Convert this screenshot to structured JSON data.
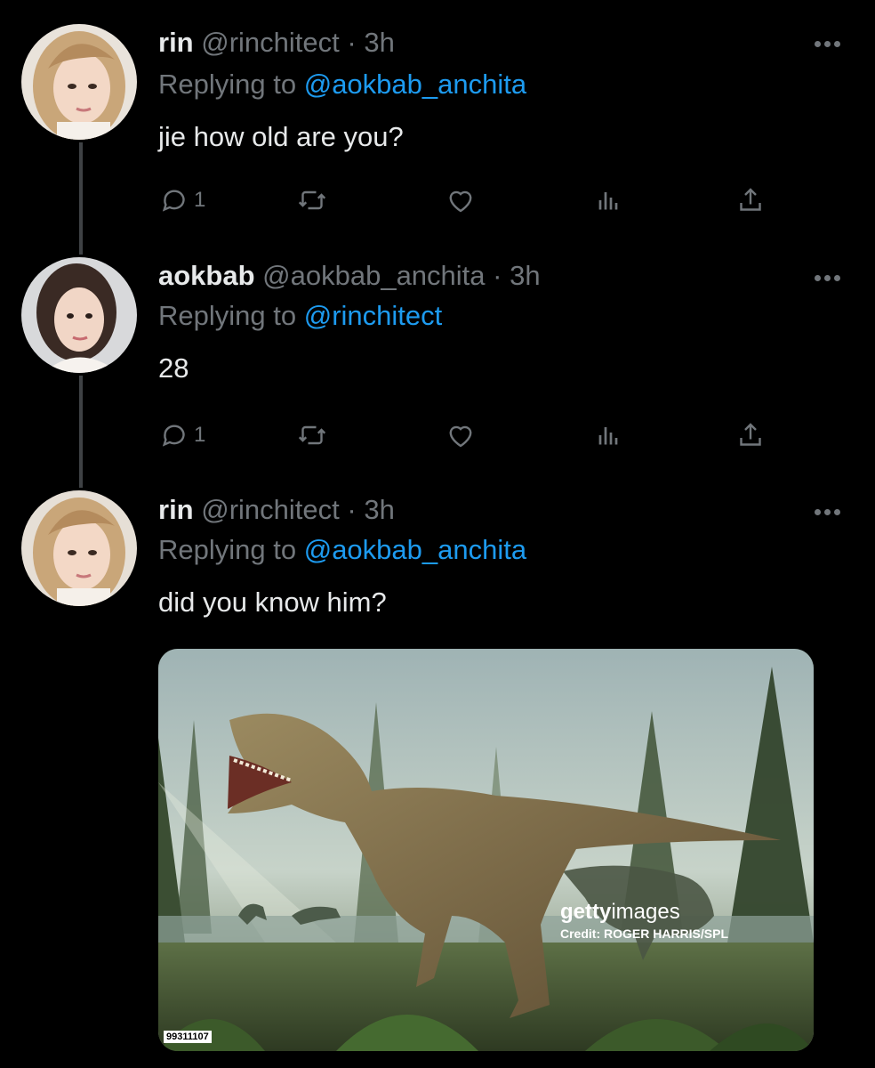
{
  "tweets": [
    {
      "name": "rin",
      "handle": "@rinchitect",
      "time": "· 3h",
      "replying_prefix": "Replying to",
      "replying_to": "@aokbab_anchita",
      "text": "jie how old are you?",
      "reply_count": "1"
    },
    {
      "name": "aokbab",
      "handle": "@aokbab_anchita",
      "time": "· 3h",
      "replying_prefix": "Replying to",
      "replying_to": "@rinchitect",
      "text": "28",
      "reply_count": "1"
    },
    {
      "name": "rin",
      "handle": "@rinchitect",
      "time": "· 3h",
      "replying_prefix": "Replying to",
      "replying_to": "@aokbab_anchita",
      "text": "did you know him?",
      "media": {
        "watermark_brand_bold": "getty",
        "watermark_brand": "images",
        "credit": "Credit: ROGER HARRIS/SPL",
        "image_id": "99311107"
      }
    }
  ],
  "colors": {
    "background": "#000000",
    "text": "#e7e9ea",
    "muted": "#71767b",
    "mention": "#1d9bf0"
  },
  "icons": [
    "reply-icon",
    "retweet-icon",
    "like-icon",
    "views-icon",
    "share-icon",
    "more-icon"
  ]
}
